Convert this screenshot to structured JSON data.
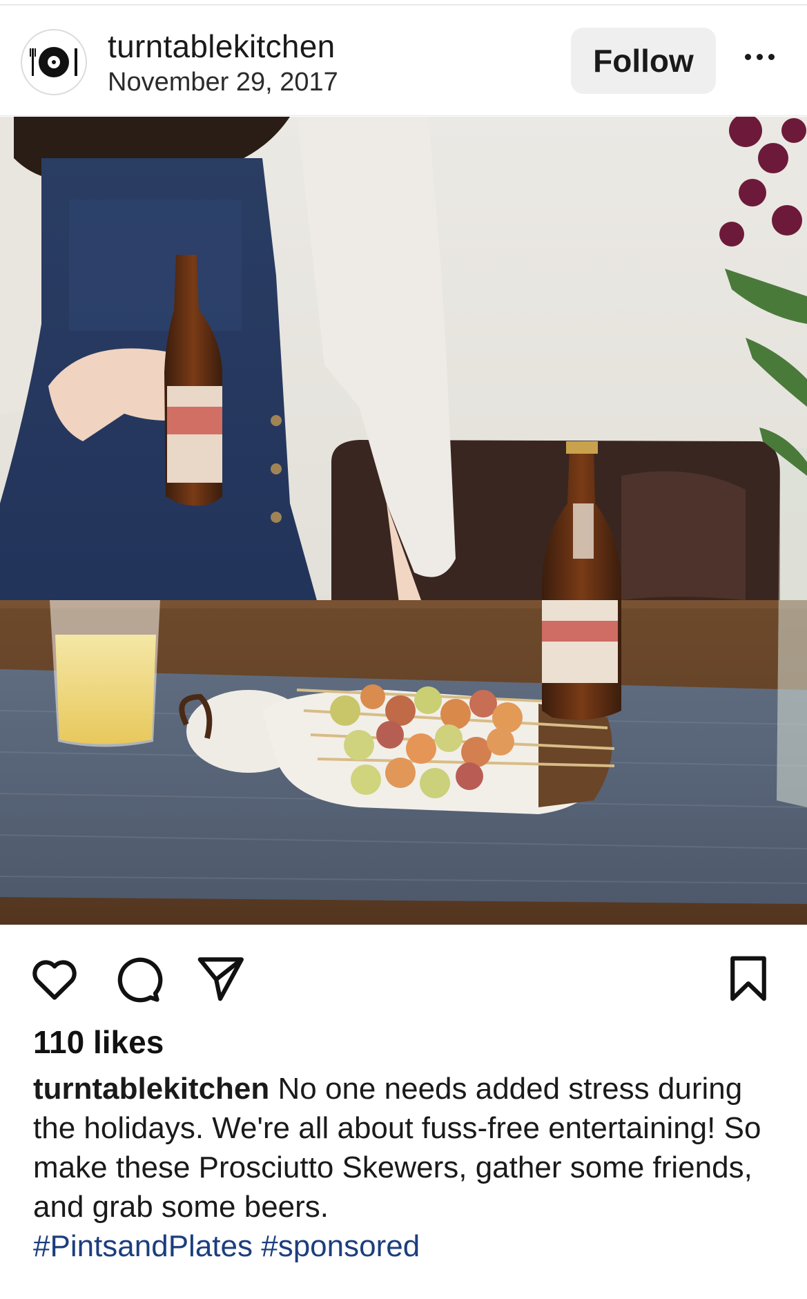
{
  "post": {
    "username": "turntablekitchen",
    "date": "November 29, 2017",
    "follow_label": "Follow",
    "more_icon": "more-horizontal-icon",
    "avatar_icon": "turntable-logo-icon",
    "likes": "110 likes",
    "caption": {
      "username": "turntablekitchen",
      "text": "No one needs added stress during the holidays. We're all about fuss-free entertaining! So make these Prosciutto Skewers, gather some friends, and grab some beers.",
      "hashtags": [
        "#PintsandPlates",
        "#sponsored"
      ]
    },
    "actions": {
      "like_icon": "heart-icon",
      "comment_icon": "comment-icon",
      "share_icon": "send-icon",
      "save_icon": "bookmark-icon"
    }
  },
  "colors": {
    "hashtag": "#1c3e7d",
    "follow_bg": "#efefef",
    "text": "#1a1a1a"
  }
}
